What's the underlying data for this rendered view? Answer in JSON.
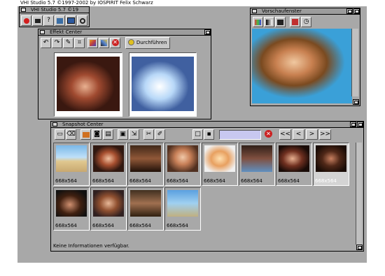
{
  "app": {
    "screen_title": "VHI Studio 5.7 ©1997-2002 by IOSPIRIT Felix Schwarz"
  },
  "main_window": {
    "title": "VHI Studio 5.7 ©19",
    "tools": [
      "record-icon",
      "camera-icon",
      "help-icon",
      "settings-icon",
      "monitor-icon",
      "film-reel-icon"
    ]
  },
  "effekt": {
    "title": "Effekt Center",
    "execute_label": "Durchführen",
    "tools": [
      "undo-icon",
      "redo-icon",
      "brush-icon",
      "crop-icon",
      "palette-icon",
      "gradient-icon",
      "cancel-icon"
    ],
    "colors": {
      "accent": "#cc2222"
    }
  },
  "preview": {
    "title": "Vorschaufenster"
  },
  "snapshot": {
    "title": "Snapshot Center",
    "nav": [
      "<<",
      "<",
      ">",
      ">>"
    ],
    "status": "Keine Informationen verfügbar.",
    "thumbnails": [
      {
        "caption": "668x564",
        "scene": "beach"
      },
      {
        "caption": "668x564",
        "scene": "singer-red"
      },
      {
        "caption": "668x564",
        "scene": "club-crowd"
      },
      {
        "caption": "668x564",
        "scene": "closeup-smile"
      },
      {
        "caption": "668x564",
        "scene": "bright-stage"
      },
      {
        "caption": "668x564",
        "scene": "bar-dance"
      },
      {
        "caption": "668x564",
        "scene": "sunglasses"
      },
      {
        "caption": "668x564",
        "scene": "dark-club",
        "selected": true
      },
      {
        "caption": "668x564",
        "scene": "hands-dark"
      },
      {
        "caption": "668x564",
        "scene": "singer-close"
      },
      {
        "caption": "668x564",
        "scene": "bar-group"
      },
      {
        "caption": "668x564",
        "scene": "beach-group"
      }
    ]
  }
}
